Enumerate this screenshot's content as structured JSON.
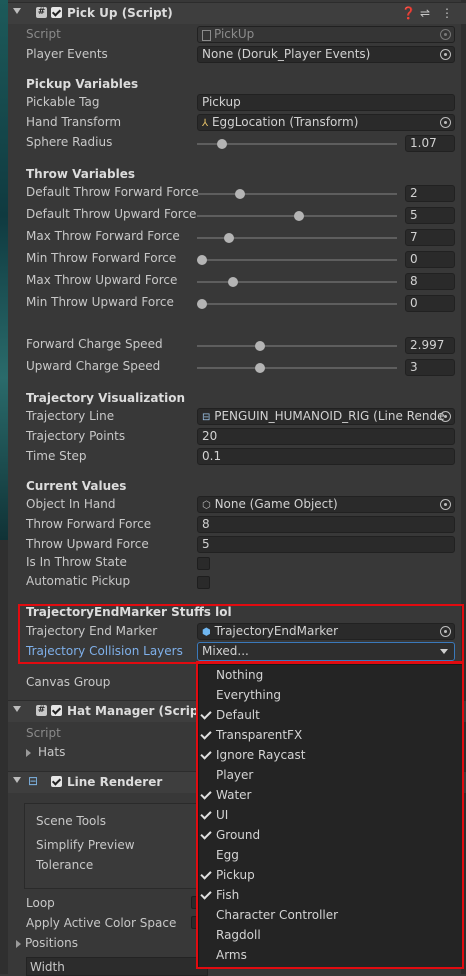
{
  "pickup_component": {
    "title": "Pick Up (Script)",
    "script_label": "Script",
    "script_value": "PickUp",
    "player_events_label": "Player Events",
    "player_events_value": "None (Doruk_Player Events)",
    "pickup_vars_header": "Pickup Variables",
    "pickable_tag_label": "Pickable Tag",
    "pickable_tag_value": "Pickup",
    "hand_transform_label": "Hand Transform",
    "hand_transform_value": "EggLocation (Transform)",
    "sphere_radius_label": "Sphere Radius",
    "sphere_radius_value": "1.07",
    "throw_vars_header": "Throw Variables",
    "default_throw_forward_label": "Default Throw Forward Force",
    "default_throw_forward_value": "2",
    "default_throw_upward_label": "Default Throw Upward Force",
    "default_throw_upward_value": "5",
    "max_throw_forward_label": "Max Throw Forward Force",
    "max_throw_forward_value": "7",
    "min_throw_forward_label": "Min Throw Forward Force",
    "min_throw_forward_value": "0",
    "max_throw_upward_label": "Max Throw Upward Force",
    "max_throw_upward_value": "8",
    "min_throw_upward_label": "Min Throw Upward Force",
    "min_throw_upward_value": "0",
    "forward_charge_label": "Forward Charge Speed",
    "forward_charge_value": "2.997",
    "upward_charge_label": "Upward Charge Speed",
    "upward_charge_value": "3",
    "traj_vis_header": "Trajectory Visualization",
    "traj_line_label": "Trajectory Line",
    "traj_line_value": "PENGUIN_HUMANOID_RIG (Line Rende",
    "traj_points_label": "Trajectory Points",
    "traj_points_value": "20",
    "time_step_label": "Time Step",
    "time_step_value": "0.1",
    "current_values_header": "Current Values",
    "object_in_hand_label": "Object In Hand",
    "object_in_hand_value": "None (Game Object)",
    "throw_forward_force_label": "Throw Forward Force",
    "throw_forward_force_value": "8",
    "throw_upward_force_label": "Throw Upward Force",
    "throw_upward_force_value": "5",
    "is_in_throw_state_label": "Is In Throw State",
    "automatic_pickup_label": "Automatic Pickup",
    "end_marker_header": "TrajectoryEndMarker Stuffs lol",
    "traj_end_marker_label": "Trajectory End Marker",
    "traj_end_marker_value": "TrajectoryEndMarker",
    "traj_collision_label": "Trajectory Collision Layers",
    "traj_collision_value": "Mixed...",
    "canvas_group_label": "Canvas Group"
  },
  "hat_manager": {
    "title": "Hat Manager (Script)",
    "script_label": "Script",
    "hats_label": "Hats"
  },
  "line_renderer": {
    "title": "Line Renderer",
    "scene_tools_label": "Scene Tools",
    "simplify_preview_label": "Simplify Preview",
    "tolerance_label": "Tolerance",
    "loop_label": "Loop",
    "apply_color_space_label": "Apply Active Color Space",
    "positions_label": "Positions",
    "width_label": "Width"
  },
  "layer_menu": {
    "items": [
      {
        "label": "Nothing",
        "checked": false
      },
      {
        "label": "Everything",
        "checked": false
      },
      {
        "label": "Default",
        "checked": true
      },
      {
        "label": "TransparentFX",
        "checked": true
      },
      {
        "label": "Ignore Raycast",
        "checked": true
      },
      {
        "label": "Player",
        "checked": false
      },
      {
        "label": "Water",
        "checked": true
      },
      {
        "label": "UI",
        "checked": true
      },
      {
        "label": "Ground",
        "checked": true
      },
      {
        "label": "Egg",
        "checked": false
      },
      {
        "label": "Pickup",
        "checked": true
      },
      {
        "label": "Fish",
        "checked": true
      },
      {
        "label": "Character Controller",
        "checked": false
      },
      {
        "label": "Ragdoll",
        "checked": false
      },
      {
        "label": "Arms",
        "checked": false
      }
    ]
  },
  "colors": {
    "highlight_red": "#e10b10",
    "link_blue": "#7fb0ea",
    "panel_bg": "#383838"
  }
}
